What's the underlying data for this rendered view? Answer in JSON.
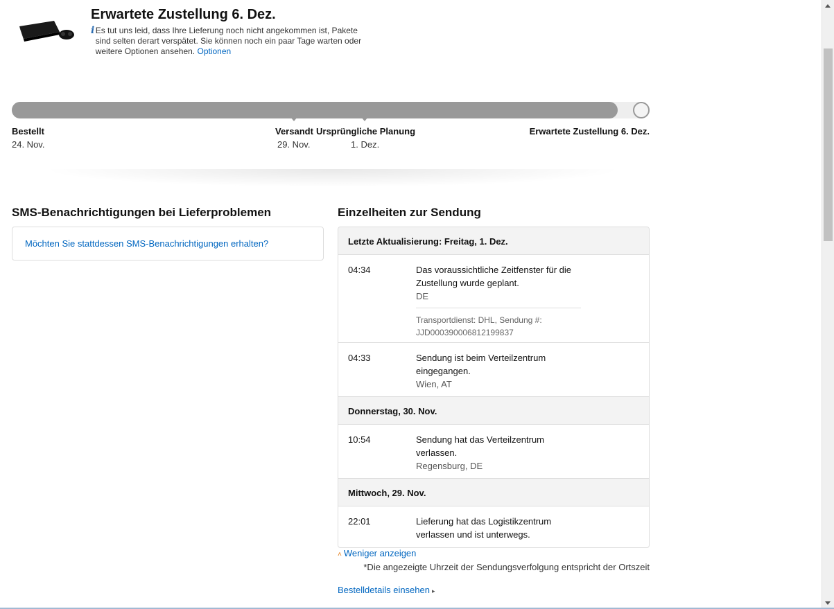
{
  "header": {
    "title": "Erwartete Zustellung 6. Dez.",
    "info_text": "Es tut uns leid, dass Ihre Lieferung noch nicht angekommen ist, Pakete sind selten derart verspätet. Sie können noch ein paar Tage warten oder weitere Optionen ansehen.",
    "info_link": "Optionen"
  },
  "progress": {
    "fill_fraction": 0.95,
    "milestones": [
      {
        "label": "Bestellt",
        "date": "24. Nov."
      },
      {
        "label": "Versandt",
        "date": "29. Nov."
      },
      {
        "label": "Ursprüngliche Planung",
        "date": "1. Dez."
      },
      {
        "label": "Erwartete Zustellung 6. Dez.",
        "date": ""
      }
    ]
  },
  "sms": {
    "title": "SMS-Benachrichtigungen bei Lieferproblemen",
    "link": "Möchten Sie stattdessen SMS-Benachrichtigungen erhalten?"
  },
  "shipment": {
    "title": "Einzelheiten zur Sendung",
    "groups": [
      {
        "day": "Letzte Aktualisierung: Freitag, 1. Dez.",
        "events": [
          {
            "time": "04:34",
            "desc": "Das voraussichtliche Zeitfenster für die Zustellung wurde geplant.",
            "loc": "DE",
            "carrier": "Transportdienst: DHL, Sendung #: JJD000390006812199837"
          },
          {
            "time": "04:33",
            "desc": "Sendung ist beim Verteilzentrum eingegangen.",
            "loc": "Wien, AT"
          }
        ]
      },
      {
        "day": "Donnerstag, 30. Nov.",
        "events": [
          {
            "time": "10:54",
            "desc": "Sendung hat das Verteilzentrum verlassen.",
            "loc": "Regensburg, DE"
          }
        ]
      },
      {
        "day": "Mittwoch, 29. Nov.",
        "events": [
          {
            "time": "22:01",
            "desc": "Lieferung hat das Logistikzentrum verlassen und ist unterwegs.",
            "loc": ""
          }
        ]
      }
    ],
    "show_less": "Weniger anzeigen",
    "note": "*Die angezeigte Uhrzeit der Sendungsverfolgung entspricht der Ortszeit",
    "order_details": "Bestelldetails einsehen"
  },
  "icons": {
    "info": "info-icon",
    "chevron_up": "chevron-up-icon",
    "caret_right": "caret-right-icon"
  }
}
